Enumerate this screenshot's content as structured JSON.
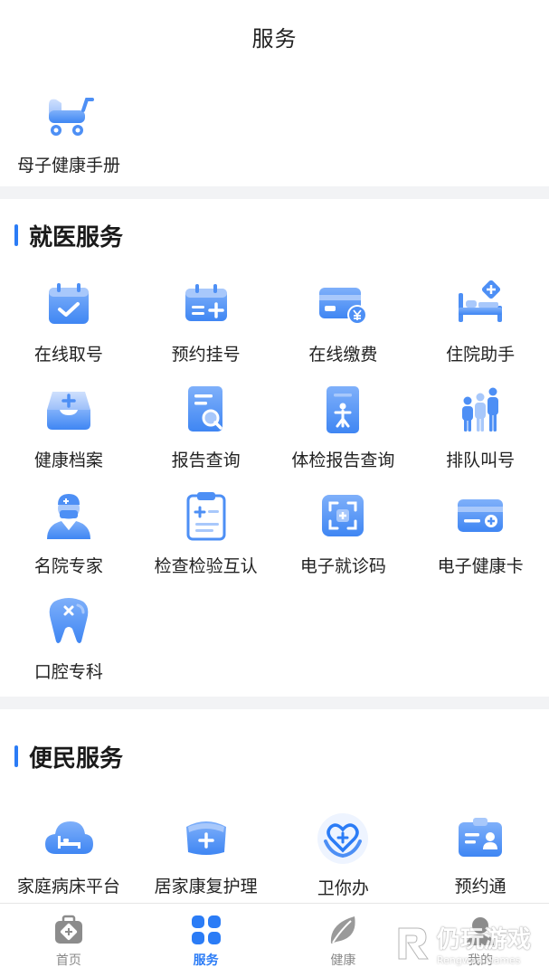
{
  "header": {
    "title": "服务"
  },
  "featured": {
    "label": "母子健康手册",
    "icon": "stroller-icon"
  },
  "medical": {
    "title": "就医服务",
    "items": [
      {
        "label": "在线取号",
        "icon": "calendar-check-icon"
      },
      {
        "label": "预约挂号",
        "icon": "calendar-add-icon"
      },
      {
        "label": "在线缴费",
        "icon": "card-yuan-icon"
      },
      {
        "label": "住院助手",
        "icon": "hospital-bed-icon"
      },
      {
        "label": "健康档案",
        "icon": "tray-add-icon"
      },
      {
        "label": "报告查询",
        "icon": "report-search-icon"
      },
      {
        "label": "体检报告查询",
        "icon": "checkup-report-icon"
      },
      {
        "label": "排队叫号",
        "icon": "queue-people-icon"
      },
      {
        "label": "名院专家",
        "icon": "doctor-icon"
      },
      {
        "label": "检查检验互认",
        "icon": "clipboard-icon"
      },
      {
        "label": "电子就诊码",
        "icon": "scan-code-icon"
      },
      {
        "label": "电子健康卡",
        "icon": "health-card-icon"
      },
      {
        "label": "口腔专科",
        "icon": "tooth-icon"
      }
    ]
  },
  "convenience": {
    "title": "便民服务",
    "items": [
      {
        "label": "家庭病床平台",
        "icon": "cloud-bed-icon"
      },
      {
        "label": "居家康复护理",
        "icon": "nurse-cap-icon"
      },
      {
        "label": "卫你办",
        "icon": "heart-hands-icon"
      },
      {
        "label": "预约通",
        "icon": "id-badge-icon"
      }
    ]
  },
  "tabbar": {
    "tabs": [
      {
        "label": "首页",
        "icon": "medkit-icon"
      },
      {
        "label": "服务",
        "icon": "grid-icon",
        "active": true
      },
      {
        "label": "健康",
        "icon": "leaf-icon"
      },
      {
        "label": "我的",
        "icon": "user-icon"
      }
    ]
  },
  "watermark": {
    "text": "仍玩游戏",
    "sub": "Rengwan Games"
  },
  "colors": {
    "accent": "#2b7cf6",
    "icon_light": "#a8c8fb",
    "icon_dark": "#4d8ff5"
  }
}
